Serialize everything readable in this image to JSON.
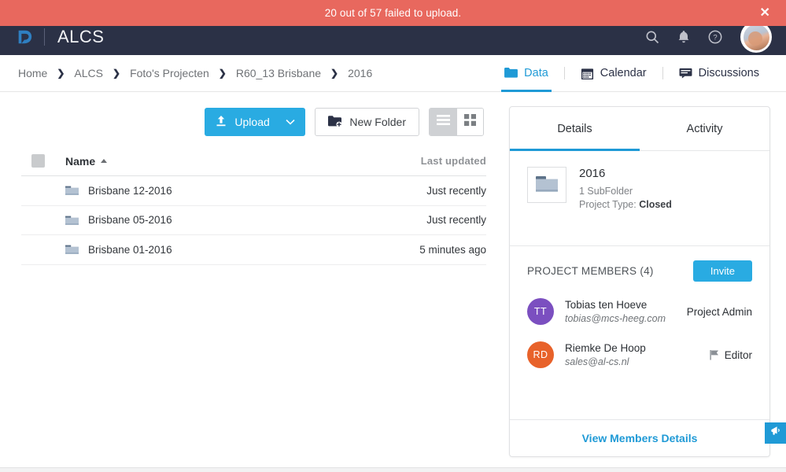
{
  "banner": {
    "message": "20 out of 57 failed to upload.",
    "close_label": "✕",
    "bg_color": "#e8685e"
  },
  "topnav": {
    "logo_name": "huddle-logo",
    "app_title": "ALCS",
    "bg_color": "#2b3146",
    "icons": [
      {
        "name": "search-icon",
        "label": "Search"
      },
      {
        "name": "bell-icon",
        "label": "Notifications"
      },
      {
        "name": "help-icon",
        "label": "Help"
      }
    ],
    "avatar_label": "User account"
  },
  "breadcrumb": {
    "separator": "❯",
    "items": [
      {
        "label": "Home"
      },
      {
        "label": "ALCS"
      },
      {
        "label": "Foto's Projecten"
      },
      {
        "label": "R60_13 Brisbane"
      },
      {
        "label": "2016"
      }
    ]
  },
  "top_tabs": {
    "active": "Data",
    "items": [
      {
        "label": "Data",
        "icon": "folder-icon",
        "active": true
      },
      {
        "label": "Calendar",
        "icon": "calendar-icon",
        "active": false
      },
      {
        "label": "Discussions",
        "icon": "comment-icon",
        "active": false
      }
    ]
  },
  "toolbar": {
    "upload_label": "Upload",
    "upload_caret": "chevron-down-icon",
    "new_folder_label": "New Folder",
    "view_list_label": "List view",
    "view_grid_label": "Grid view",
    "active_view": "list",
    "accent_color": "#29abe2"
  },
  "file_table": {
    "columns": {
      "name": "Name",
      "last_updated": "Last updated"
    },
    "sort": {
      "column": "Name",
      "direction": "asc"
    },
    "rows": [
      {
        "name": "Brisbane 12-2016",
        "last_updated": "Just recently"
      },
      {
        "name": "Brisbane 05-2016",
        "last_updated": "Just recently"
      },
      {
        "name": "Brisbane 01-2016",
        "last_updated": "5 minutes ago"
      }
    ]
  },
  "right_panel": {
    "tabs": [
      {
        "label": "Details",
        "active": true
      },
      {
        "label": "Activity",
        "active": false
      }
    ],
    "details": {
      "title": "2016",
      "subfolders": "1 SubFolder",
      "project_type_label": "Project Type:",
      "project_type_value": "Closed"
    },
    "members": {
      "heading": "PROJECT MEMBERS (4)",
      "invite_label": "Invite",
      "list": [
        {
          "initials": "TT",
          "avatar_color": "#7b4fc0",
          "name": "Tobias ten Hoeve",
          "email": "tobias@mcs-heeg.com",
          "role": "Project Admin",
          "role_icon": false
        },
        {
          "initials": "RD",
          "avatar_color": "#e8622a",
          "name": "Riemke De Hoop",
          "email": "sales@al-cs.nl",
          "role": "Editor",
          "role_icon": true
        }
      ]
    },
    "footer_link": "View Members Details"
  },
  "feedback_tab": {
    "icon": "megaphone-icon",
    "color": "#1f9ad6"
  }
}
